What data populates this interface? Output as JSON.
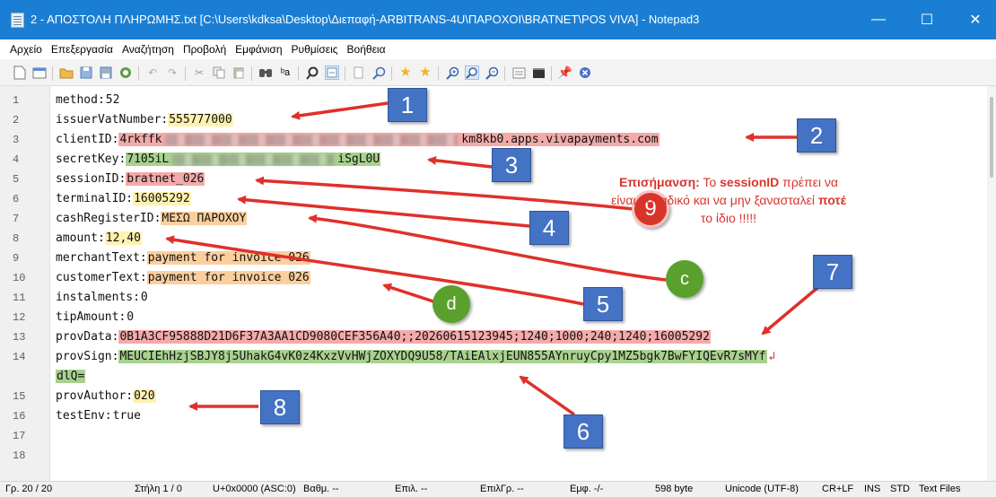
{
  "window": {
    "title": "2 - ΑΠΟΣΤΟΛΗ ΠΛΗΡΩΜΗΣ.txt [C:\\Users\\kdksa\\Desktop\\Διεπαφή-ARBITRANS-4U\\ΠΑΡΟΧΟΙ\\BRATNET\\POS VIVA] - Notepad3",
    "minimize": "—",
    "maximize": "☐",
    "close": "✕",
    "colors": {
      "titlebar": "#1a7fd4"
    }
  },
  "menu": [
    "Αρχείο",
    "Επεξεργασία",
    "Αναζήτηση",
    "Προβολή",
    "Εμφάνιση",
    "Ρυθμίσεις",
    "Βοήθεια"
  ],
  "toolbar": [
    "new-icon",
    "new-window-icon",
    "open-folder-icon",
    "save-icon",
    "save-as-icon",
    "browse-icon",
    "undo-icon",
    "redo-icon",
    "cut-icon",
    "copy-icon",
    "paste-icon",
    "find-icon",
    "replace-icon",
    "find-next-icon",
    "word-wrap-icon",
    "zoom-page-icon",
    "zoom-find-icon",
    "favorite-icon",
    "add-favorite-icon",
    "zoom-in-icon",
    "zoom-reset-icon",
    "zoom-out-icon",
    "scheme-icon",
    "console-icon",
    "pin-icon",
    "exit-icon"
  ],
  "lines": [
    {
      "n": "1",
      "key": "method:",
      "value": "52",
      "hl": "none"
    },
    {
      "n": "2",
      "key": "issuerVatNumber:",
      "value": "555777000",
      "hl": "yellow"
    },
    {
      "n": "3",
      "key": "clientID:",
      "value": "4rkffk",
      "masked": true,
      "suffix": "km8kb0.apps.vivapayments.com",
      "hl": "red"
    },
    {
      "n": "4",
      "key": "secretKey:",
      "value": "7105iL",
      "masked": true,
      "suffix": "iSgL0U",
      "hl": "green"
    },
    {
      "n": "5",
      "key": "sessionID:",
      "value": "bratnet_026",
      "hl": "red"
    },
    {
      "n": "6",
      "key": "terminalID:",
      "value": "16005292",
      "hl": "yellow"
    },
    {
      "n": "7",
      "key": "cashRegisterID:",
      "value": "ΜΕΣΩ ΠΑΡΟΧΟΥ",
      "hl": "orange"
    },
    {
      "n": "8",
      "key": "amount:",
      "value": "12,40",
      "hl": "yellow"
    },
    {
      "n": "9",
      "key": "merchantText:",
      "value": "payment for invoice 026",
      "hl": "orange"
    },
    {
      "n": "10",
      "key": "customerText:",
      "value": "payment for invoice 026",
      "hl": "orange"
    },
    {
      "n": "11",
      "key": "instalments:",
      "value": "0",
      "hl": "none"
    },
    {
      "n": "12",
      "key": "tipAmount:",
      "value": "0",
      "hl": "none"
    },
    {
      "n": "13",
      "key": "provData:",
      "value": "0B1A3CF95888D21D6F37A3AA1CD9080CEF356A40;;20260615123945;1240;1000;240;1240;16005292",
      "hl": "red"
    },
    {
      "n": "14",
      "key": "provSign:",
      "value": "MEUCIEhHzjSBJY8j5UhakG4vK0z4KxzVvHWjZOXYDQ9U58/TAiEAlxjEUN855AYnruyCpy1MZ5bgk7BwFYIQEvR7sMYf",
      "hl": "green",
      "wrapMark": "↲"
    },
    {
      "n": "",
      "key": "",
      "value": "dlQ=",
      "hl": "green"
    },
    {
      "n": "15",
      "key": "provAuthor:",
      "value": "020",
      "hl": "yellow"
    },
    {
      "n": "16",
      "key": "testEnv:",
      "value": "true",
      "hl": "none"
    },
    {
      "n": "17",
      "key": "",
      "value": "",
      "hl": "none"
    },
    {
      "n": "18",
      "key": "",
      "value": "",
      "hl": "none"
    }
  ],
  "highlight_colors": {
    "yellow": "#fff2b0",
    "red": "#f4aaaa",
    "green": "#a9d18e",
    "orange": "#fbcf9d"
  },
  "annotations": {
    "badges": [
      "1",
      "2",
      "3",
      "4",
      "5",
      "6",
      "7",
      "8"
    ],
    "circle_red": "9",
    "circle_c": "c",
    "circle_d": "d",
    "badge_color": "#4472c4",
    "arrow_color": "#e0302a",
    "note": {
      "label": "Επισήμανση:",
      "t1": " Το ",
      "session": "sessionID",
      "t2": " πρέπει να είναι μοναδικό και να μην ξανασταλεί ",
      "never": "ποτέ",
      "t3": " το ίδιο !!!!!"
    }
  },
  "status": {
    "line": "Γρ. 20 / 20",
    "col": "Στήλη 1 / 0",
    "char": "U+0x0000 (ASC:0)",
    "grade": "Βαθμ. --",
    "sel": "Επιλ. --",
    "selLines": "ΕπιλΓρ. --",
    "occ": "Εμφ. -/-",
    "size": "598 byte",
    "enc": "Unicode (UTF-8)",
    "eol": "CR+LF",
    "ins": "INS",
    "std": "STD",
    "type": "Text Files"
  }
}
